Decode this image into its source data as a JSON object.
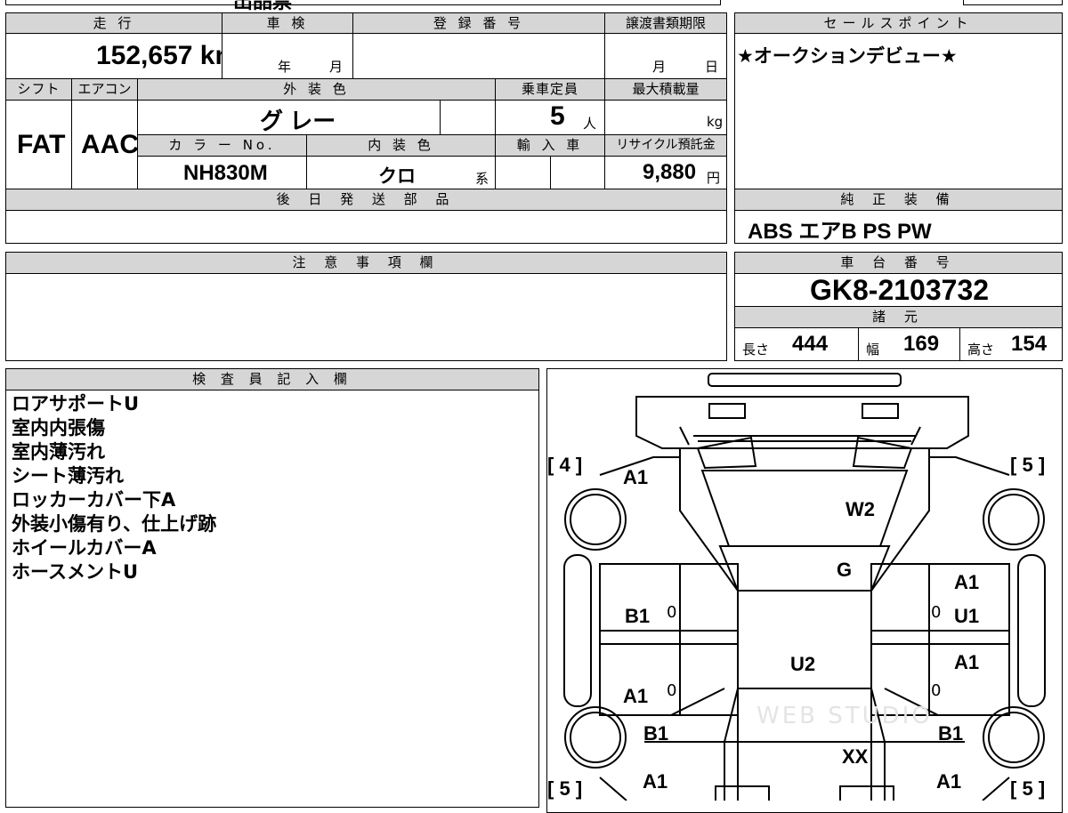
{
  "top_strip": {
    "title": "出品票"
  },
  "mileage": {
    "label": "走 行",
    "value": "152,657 km"
  },
  "inspection": {
    "label": "車 検",
    "year_unit": "年",
    "month_unit": "月"
  },
  "registration": {
    "label": "登 録 番 号"
  },
  "transfer_deadline": {
    "label": "譲渡書類期限",
    "month_unit": "月",
    "day_unit": "日"
  },
  "shift": {
    "label": "シフト",
    "value": "FAT"
  },
  "aircon": {
    "label": "エアコン",
    "value": "AAC"
  },
  "exterior_color": {
    "label": "外 装 色",
    "value": "グ レー"
  },
  "capacity": {
    "label": "乗車定員",
    "value": "5",
    "unit": "人"
  },
  "max_load": {
    "label": "最大積載量",
    "unit": "kg"
  },
  "color_no": {
    "label": "カ ラ ー No.",
    "value": "NH830M"
  },
  "interior_color": {
    "label": "内 装 色",
    "value": "クロ",
    "suffix": "系"
  },
  "import": {
    "label": "輸 入 車"
  },
  "recycle": {
    "label": "リサイクル預託金",
    "value": "9,880",
    "unit": "円"
  },
  "later_parts": {
    "label": "後 日 発 送 部 品"
  },
  "sales_point": {
    "label": "セールスポイント",
    "value": "★オークションデビュー★"
  },
  "equipment": {
    "label": "純 正 装 備",
    "value": "ABS エアB PS PW"
  },
  "cautions": {
    "label": "注 意 事 項 欄"
  },
  "chassis": {
    "label": "車 台 番 号",
    "value": "GK8-2103732"
  },
  "specs": {
    "label": "諸 元",
    "length_label": "長さ",
    "length": "444",
    "width_label": "幅",
    "width": "169",
    "height_label": "高さ",
    "height": "154"
  },
  "inspector": {
    "label": "検 査 員 記 入 欄",
    "notes": [
      "ロアサポートU",
      "室内内張傷",
      "室内薄汚れ",
      "シート薄汚れ",
      "ロッカーカバー下A",
      "外装小傷有り、仕上げ跡",
      "ホイールカバーA",
      "ホースメントU"
    ]
  },
  "diagram": {
    "tire_front_left": "4",
    "tire_front_right": "5",
    "tire_rear_left": "5",
    "tire_rear_right": "5",
    "marks": {
      "front_left_fender": "A1",
      "windshield": "W2",
      "roof_front": "G",
      "right_front_door_a": "A1",
      "right_front_door_u": "U1",
      "right_rear_door": "A1",
      "left_front_door": "B1",
      "left_rear_door": "A1",
      "roof": "U2",
      "left_rear_fender": "B1",
      "left_rear_bumper": "A1",
      "right_rear_fender": "B1",
      "right_rear_bumper": "A1",
      "tailgate": "XX"
    },
    "zero_marks": [
      "0",
      "0",
      "0",
      "0"
    ],
    "watermark": "WEB STUDIO"
  }
}
